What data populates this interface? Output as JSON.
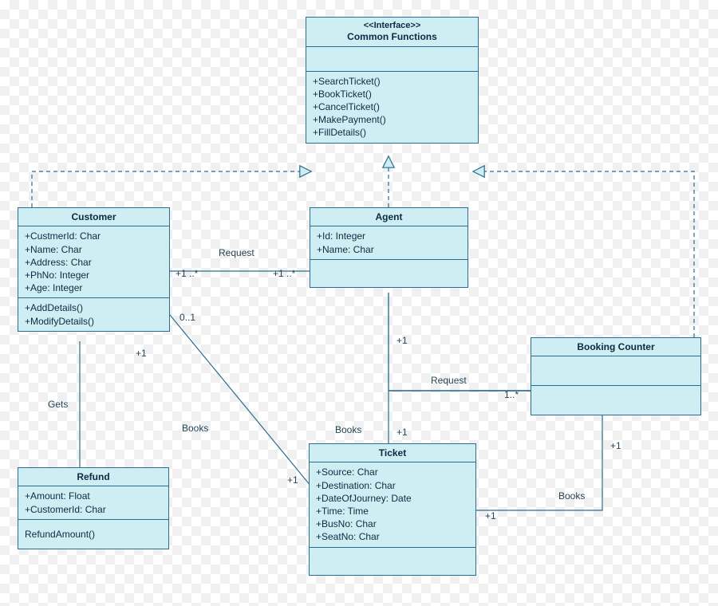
{
  "classes": {
    "commonFunctions": {
      "stereotype": "<<Interface>>",
      "name": "Common Functions",
      "attributes": [],
      "operations": [
        "+SearchTicket()",
        "+BookTicket()",
        "+CancelTicket()",
        "+MakePayment()",
        "+FillDetails()"
      ]
    },
    "customer": {
      "name": "Customer",
      "attributes": [
        "+CustmerId: Char",
        "+Name: Char",
        "+Address: Char",
        "+PhNo: Integer",
        "+Age: Integer"
      ],
      "operations": [
        "+AddDetails()",
        "+ModifyDetails()"
      ]
    },
    "agent": {
      "name": "Agent",
      "attributes": [
        "+Id: Integer",
        "+Name: Char"
      ],
      "operations": []
    },
    "bookingCounter": {
      "name": "Booking Counter",
      "attributes": [],
      "operations": []
    },
    "ticket": {
      "name": "Ticket",
      "attributes": [
        "+Source: Char",
        "+Destination: Char",
        "+DateOfJourney: Date",
        "+Time: Time",
        "+BusNo: Char",
        "+SeatNo: Char"
      ],
      "operations": []
    },
    "refund": {
      "name": "Refund",
      "attributes": [
        "+Amount: Float",
        "+CustomerId: Char"
      ],
      "operations": [
        "RefundAmount()"
      ]
    }
  },
  "labels": {
    "request1": "Request",
    "mult_cust_agent_left": "+1 ..*",
    "mult_cust_agent_right": "+1 ..*",
    "mult_cust_refund_top": "+1",
    "gets": "Gets",
    "mult_cust_ticket_01": "0..1",
    "books_cust": "Books",
    "mult_cust_ticket_bottom": "+1",
    "books_agent": "Books",
    "mult_agent_ticket_top": "+1",
    "mult_agent_ticket_bottom": "+1",
    "request2": "Request",
    "mult_booking_right": "1..*",
    "books_counter": "Books",
    "mult_counter_ticket_top": "+1",
    "mult_counter_ticket_left": "+1"
  }
}
